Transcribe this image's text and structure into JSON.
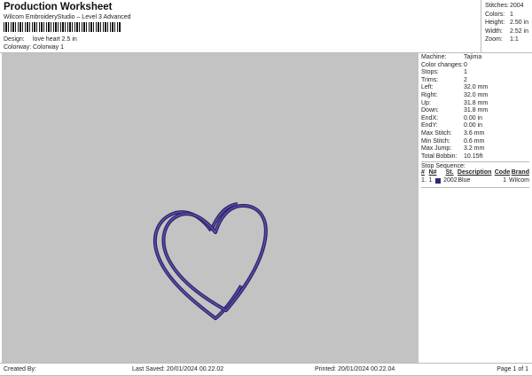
{
  "header": {
    "title": "Production Worksheet",
    "subtitle": "Wilcom EmbroideryStudio – Level 3 Advanced",
    "design_label": "Design:",
    "design_value": "love heart 2.5 in",
    "colorway_label": "Colorway:",
    "colorway_value": "Colorway 1"
  },
  "stats": [
    {
      "k": "Stitches:",
      "v": "2004"
    },
    {
      "k": "Colors:",
      "v": "1"
    },
    {
      "k": "Height:",
      "v": "2.50 in"
    },
    {
      "k": "Width:",
      "v": "2.52 in"
    },
    {
      "k": "Zoom:",
      "v": "1:1"
    }
  ],
  "details": [
    {
      "k": "Machine:",
      "v": "Tajima"
    },
    {
      "k": "Color changes:",
      "v": "0"
    },
    {
      "k": "Stops:",
      "v": "1"
    },
    {
      "k": "Trims:",
      "v": "2"
    },
    {
      "k": "Left:",
      "v": "32.0 mm"
    },
    {
      "k": "Right:",
      "v": "32.0 mm"
    },
    {
      "k": "Up:",
      "v": "31.8 mm"
    },
    {
      "k": "Down:",
      "v": "31.8 mm"
    },
    {
      "k": "EndX:",
      "v": "0.00 in"
    },
    {
      "k": "EndY:",
      "v": "0.00 in"
    },
    {
      "k": "Max Stitch:",
      "v": "3.6 mm"
    },
    {
      "k": "Min Stitch:",
      "v": "0.6 mm"
    },
    {
      "k": "Max Jump:",
      "v": "3.2 mm"
    },
    {
      "k": "Total Bobbin:",
      "v": "10.15ft"
    }
  ],
  "stop_sequence": {
    "label": "Stop Sequence:",
    "headers": [
      "#",
      "N#",
      "St.",
      "Description",
      "Code",
      "Brand"
    ],
    "rows": [
      {
        "num": "1.",
        "n": "1",
        "st": "2002",
        "desc": "Blue",
        "code": "1",
        "brand": "Wilcom",
        "color": "#2a2a7a"
      }
    ]
  },
  "footer": {
    "created": "Created By:",
    "saved": "Last Saved: 20/01/2024 00.22.02",
    "printed": "Printed: 20/01/2024 00.22.04",
    "page": "Page 1 of 1"
  },
  "colors": {
    "thread": "#4a3f94",
    "canvas": "#c3c3c3"
  }
}
